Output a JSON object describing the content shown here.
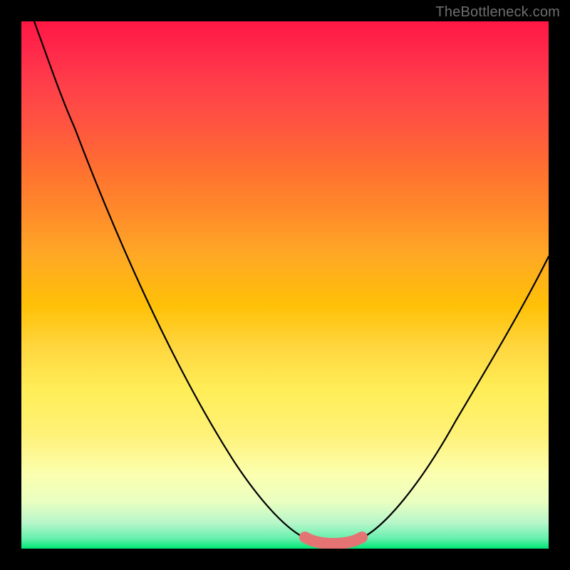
{
  "watermark": "TheBottleneck.com",
  "colors": {
    "frame": "#000000",
    "curve": "#000000",
    "highlight": "#e57373",
    "gradient_top": "#ff1744",
    "gradient_bottom": "#00e676"
  },
  "chart_data": {
    "type": "line",
    "title": "",
    "xlabel": "",
    "ylabel": "",
    "xlim": [
      0,
      100
    ],
    "ylim": [
      0,
      100
    ],
    "grid": false,
    "series": [
      {
        "name": "bottleneck-curve",
        "x": [
          2,
          6,
          10,
          14,
          18,
          22,
          26,
          30,
          34,
          38,
          42,
          46,
          50,
          54,
          56,
          58,
          60,
          62,
          64,
          68,
          72,
          76,
          80,
          84,
          88,
          92,
          96,
          100
        ],
        "y": [
          100,
          94,
          86,
          77,
          67,
          57,
          48,
          39,
          31,
          23,
          16,
          10,
          5,
          2,
          1,
          1,
          1,
          1,
          2,
          5,
          10,
          16,
          23,
          30,
          37,
          44,
          51,
          58
        ]
      }
    ],
    "annotations": [
      {
        "name": "optimal-range",
        "x_start": 54,
        "x_end": 64,
        "y": 1
      }
    ]
  }
}
